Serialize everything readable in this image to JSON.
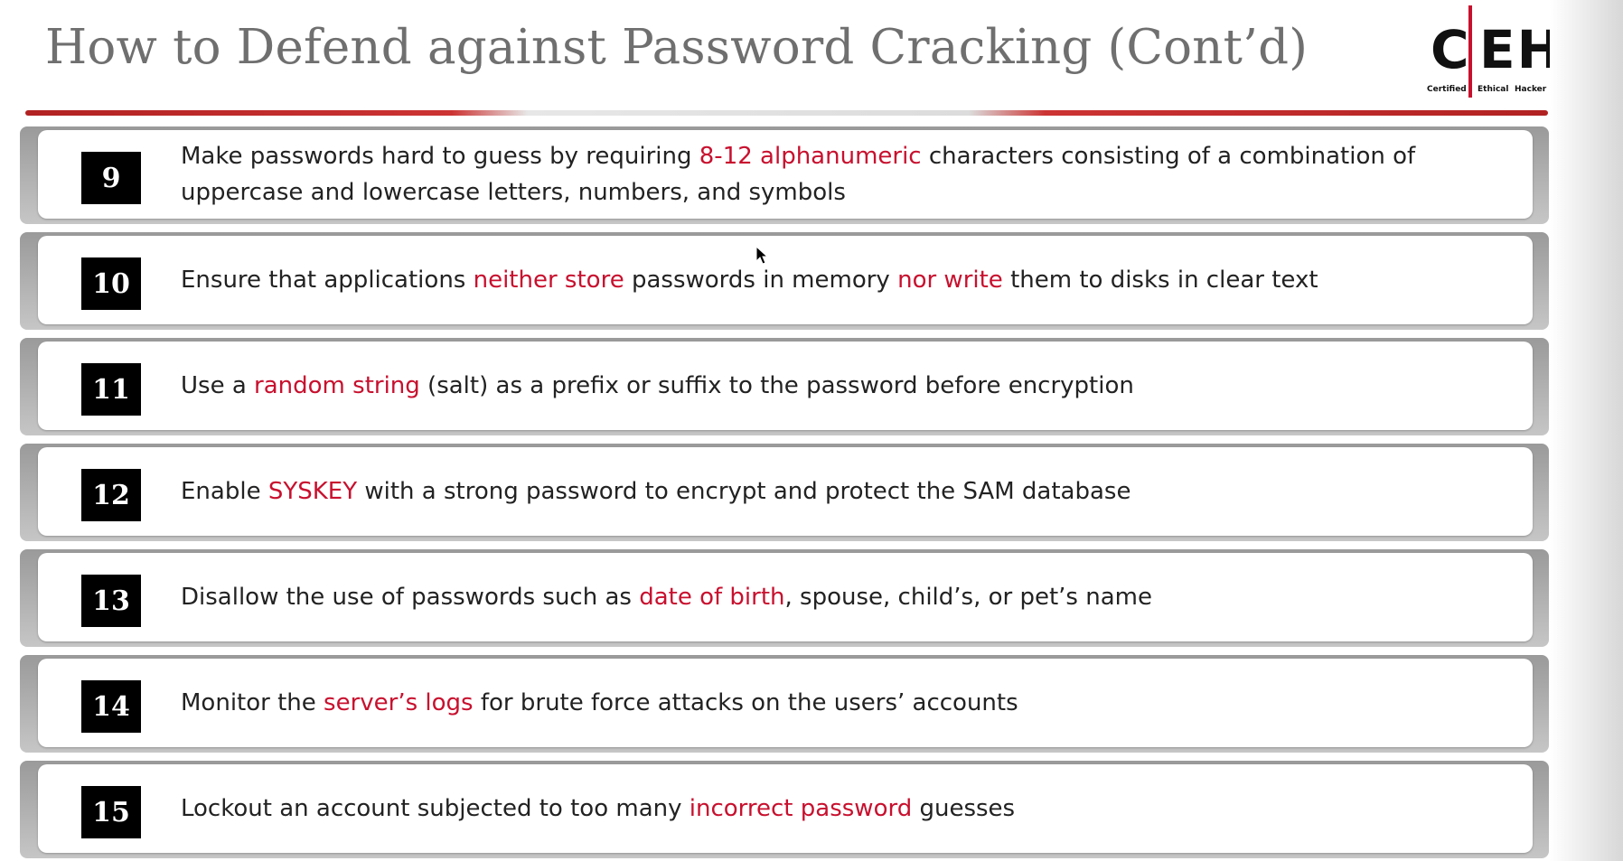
{
  "slide": {
    "title": "How to Defend against Password Cracking (Cont’d)",
    "logo": {
      "letters_c": "C",
      "letters_eh": "EH",
      "sub_certified": "Certified",
      "sub_ethical": "Ethical",
      "sub_hacker": "Hacker"
    },
    "accent_color": "#c8102e"
  },
  "items": [
    {
      "number": "9",
      "parts": [
        "Make passwords hard to guess by requiring ",
        "8-12 alphanumeric",
        " characters consisting of a combination of uppercase and lowercase letters, numbers, and symbols"
      ]
    },
    {
      "number": "10",
      "parts": [
        "Ensure that applications ",
        "neither store",
        " passwords in memory ",
        "nor write",
        " them to disks in clear text"
      ]
    },
    {
      "number": "11",
      "parts": [
        "Use a ",
        "random string",
        " (salt) as a prefix or suffix to the password before encryption"
      ]
    },
    {
      "number": "12",
      "parts": [
        "Enable ",
        "SYSKEY",
        " with a strong password to encrypt and protect the SAM database"
      ]
    },
    {
      "number": "13",
      "parts": [
        "Disallow the use of passwords such as ",
        "date of birth",
        ", spouse, child’s, or pet’s name"
      ]
    },
    {
      "number": "14",
      "parts": [
        "Monitor the ",
        "server’s logs",
        " for brute force attacks on the users’ accounts"
      ]
    },
    {
      "number": "15",
      "parts": [
        "Lockout an account subjected to too many ",
        "incorrect password",
        " guesses"
      ]
    }
  ]
}
